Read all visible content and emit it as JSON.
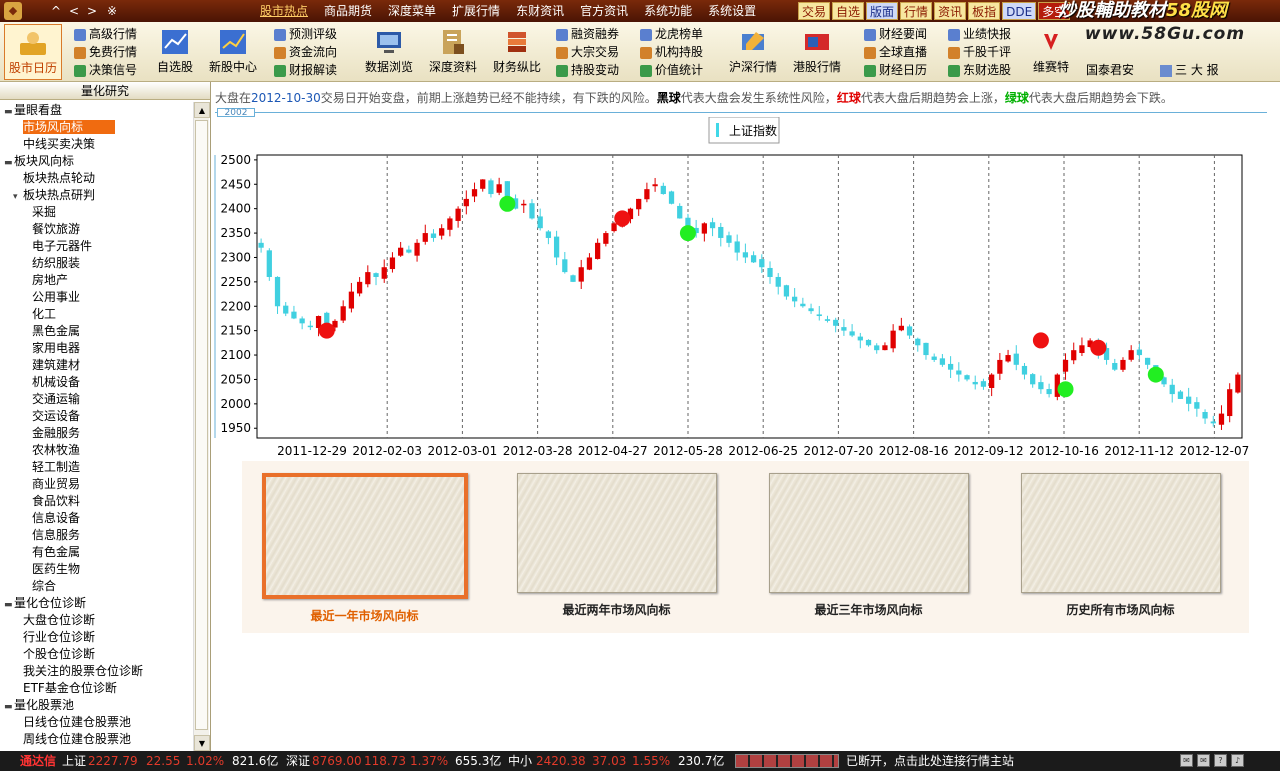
{
  "menubar": {
    "logo": "◆",
    "nav": [
      "^",
      "<",
      ">",
      "※"
    ],
    "menus": [
      {
        "label": "股市热点",
        "active": true
      },
      {
        "label": "商品期货"
      },
      {
        "label": "深度菜单"
      },
      {
        "label": "扩展行情"
      },
      {
        "label": "东财资讯"
      },
      {
        "label": "官方资讯"
      },
      {
        "label": "系统功能"
      },
      {
        "label": "系统设置"
      }
    ],
    "quick_buttons": [
      {
        "label": "交易",
        "style": ""
      },
      {
        "label": "自选",
        "style": ""
      },
      {
        "label": "版面",
        "style": "blue"
      },
      {
        "label": "行情",
        "style": ""
      },
      {
        "label": "资讯",
        "style": ""
      },
      {
        "label": "板指",
        "style": ""
      },
      {
        "label": "DDE",
        "style": "blue"
      },
      {
        "label": "多空",
        "style": "red"
      }
    ],
    "brand_a": "炒股輔助教材",
    "brand_b": "58股网"
  },
  "toolbar": {
    "url_brand": "www.58Gu.com",
    "big_buttons": [
      {
        "label": "股市日历",
        "icon": "calendar-person-icon",
        "active": true
      },
      {
        "label": "自选股",
        "icon": "chart-icon"
      },
      {
        "label": "新股中心",
        "icon": "chart-icon"
      },
      {
        "label": "数据浏览",
        "icon": "monitor-icon"
      },
      {
        "label": "深度资料",
        "icon": "document-icon"
      },
      {
        "label": "财务纵比",
        "icon": "stack-icon"
      },
      {
        "label": "沪深行情",
        "icon": "pen-icon"
      },
      {
        "label": "港股行情",
        "icon": "flag-icon"
      },
      {
        "label": "维赛特",
        "icon": "v-icon"
      }
    ],
    "col1": [
      "高级行情",
      "免费行情",
      "决策信号"
    ],
    "col2": [
      "预测评级",
      "资金流向",
      "财报解读"
    ],
    "col3": [
      "融资融券",
      "大宗交易",
      "持股变动"
    ],
    "col4": [
      "龙虎榜单",
      "机构持股",
      "价值统计"
    ],
    "col5": [
      "财经要闻",
      "全球直播",
      "财经日历"
    ],
    "col6": [
      "业绩快报",
      "千股千评",
      "东财选股"
    ],
    "extra": [
      "国泰君安",
      "三 大 报"
    ]
  },
  "left_panel": {
    "header": "量化研究",
    "tree": [
      {
        "label": "量眼看盘",
        "level": 0,
        "toggle": "▬"
      },
      {
        "label": "市场风向标",
        "level": 1,
        "selected": true
      },
      {
        "label": "中线买卖决策",
        "level": 1
      },
      {
        "label": "板块风向标",
        "level": 0,
        "toggle": "▬"
      },
      {
        "label": "板块热点轮动",
        "level": 1
      },
      {
        "label": "板块热点研判",
        "level": 1,
        "toggle": "▾"
      },
      {
        "label": "采掘",
        "level": 2
      },
      {
        "label": "餐饮旅游",
        "level": 2
      },
      {
        "label": "电子元器件",
        "level": 2
      },
      {
        "label": "纺织服装",
        "level": 2
      },
      {
        "label": "房地产",
        "level": 2
      },
      {
        "label": "公用事业",
        "level": 2
      },
      {
        "label": "化工",
        "level": 2
      },
      {
        "label": "黑色金属",
        "level": 2
      },
      {
        "label": "家用电器",
        "level": 2
      },
      {
        "label": "建筑建材",
        "level": 2
      },
      {
        "label": "机械设备",
        "level": 2
      },
      {
        "label": "交通运输",
        "level": 2
      },
      {
        "label": "交运设备",
        "level": 2
      },
      {
        "label": "金融服务",
        "level": 2
      },
      {
        "label": "农林牧渔",
        "level": 2
      },
      {
        "label": "轻工制造",
        "level": 2
      },
      {
        "label": "商业贸易",
        "level": 2
      },
      {
        "label": "食品饮料",
        "level": 2
      },
      {
        "label": "信息设备",
        "level": 2
      },
      {
        "label": "信息服务",
        "level": 2
      },
      {
        "label": "有色金属",
        "level": 2
      },
      {
        "label": "医药生物",
        "level": 2
      },
      {
        "label": "综合",
        "level": 2
      },
      {
        "label": "量化仓位诊断",
        "level": 0,
        "toggle": "▬"
      },
      {
        "label": "大盘仓位诊断",
        "level": 1
      },
      {
        "label": "行业仓位诊断",
        "level": 1
      },
      {
        "label": "个股仓位诊断",
        "level": 1
      },
      {
        "label": "我关注的股票仓位诊断",
        "level": 1
      },
      {
        "label": "ETF基金仓位诊断",
        "level": 1
      },
      {
        "label": "量化股票池",
        "level": 0,
        "toggle": "▬"
      },
      {
        "label": "日线仓位建仓股票池",
        "level": 1
      },
      {
        "label": "周线仓位建仓股票池",
        "level": 1
      }
    ]
  },
  "main": {
    "notice": {
      "p1": "大盘在",
      "date": "2012-10-30",
      "p2": "交易日开始变盘，前期上涨趋势已经不能持续，有下跌的风险。",
      "black": "黑球",
      "p3": "代表大盘会发生系统性风险，",
      "red": "红球",
      "p4": "代表大盘后期趋势会上涨，",
      "green": "绿球",
      "p5": "代表大盘后期趋势会下跌。"
    },
    "year_tab": "2002",
    "thumbs": [
      {
        "label": "最近一年市场风向标",
        "active": true
      },
      {
        "label": "最近两年市场风向标"
      },
      {
        "label": "最近三年市场风向标"
      },
      {
        "label": "历史所有市场风向标"
      }
    ]
  },
  "chart_data": {
    "type": "candlestick",
    "legend": "上证指数",
    "y_ticks": [
      1950,
      2000,
      2050,
      2100,
      2150,
      2200,
      2250,
      2300,
      2350,
      2400,
      2450,
      2500
    ],
    "ylim": [
      1930,
      2510
    ],
    "x_ticks": [
      "2011-12-29",
      "2012-02-03",
      "2012-03-01",
      "2012-03-28",
      "2012-04-27",
      "2012-05-28",
      "2012-06-25",
      "2012-07-20",
      "2012-08-16",
      "2012-09-12",
      "2012-10-16",
      "2012-11-12",
      "2012-12-07"
    ],
    "close_series": [
      2320,
      2260,
      2200,
      2185,
      2175,
      2165,
      2160,
      2180,
      2150,
      2170,
      2200,
      2230,
      2250,
      2270,
      2260,
      2280,
      2300,
      2320,
      2310,
      2330,
      2350,
      2340,
      2360,
      2380,
      2400,
      2420,
      2440,
      2460,
      2430,
      2450,
      2420,
      2400,
      2410,
      2380,
      2360,
      2340,
      2300,
      2270,
      2250,
      2280,
      2300,
      2330,
      2350,
      2370,
      2380,
      2400,
      2420,
      2440,
      2450,
      2430,
      2410,
      2380,
      2360,
      2350,
      2370,
      2360,
      2340,
      2330,
      2310,
      2300,
      2290,
      2280,
      2260,
      2240,
      2220,
      2210,
      2200,
      2190,
      2180,
      2170,
      2160,
      2150,
      2140,
      2130,
      2120,
      2110,
      2120,
      2150,
      2160,
      2140,
      2120,
      2100,
      2090,
      2080,
      2070,
      2060,
      2050,
      2040,
      2035,
      2060,
      2090,
      2100,
      2080,
      2060,
      2040,
      2030,
      2020,
      2060,
      2090,
      2110,
      2120,
      2130,
      2110,
      2090,
      2070,
      2090,
      2110,
      2100,
      2080,
      2060,
      2040,
      2020,
      2010,
      2000,
      1990,
      1970,
      1960,
      1980,
      2030,
      2060
    ],
    "markers": [
      {
        "date_index": 8,
        "value": 2150,
        "color": "red"
      },
      {
        "date_index": 30,
        "value": 2410,
        "color": "green"
      },
      {
        "date_index": 44,
        "value": 2380,
        "color": "red"
      },
      {
        "date_index": 52,
        "value": 2350,
        "color": "green"
      },
      {
        "date_index": 95,
        "value": 2130,
        "color": "red"
      },
      {
        "date_index": 98,
        "value": 2030,
        "color": "green"
      },
      {
        "date_index": 102,
        "value": 2115,
        "color": "red"
      },
      {
        "date_index": 109,
        "value": 2060,
        "color": "green"
      }
    ]
  },
  "statusbar": {
    "brand": "通达信",
    "sh_label": "上证",
    "sh_value": "2227.79",
    "sh_change": "22.55",
    "sh_pct": "1.02%",
    "sh_amount": "821.6亿",
    "sz_label": "深证",
    "sz_value": "8769.00",
    "sz_change": "118.73",
    "sz_pct": "1.37%",
    "sz_amount": "655.3亿",
    "zx_label": "中小",
    "zx_value": "2420.38",
    "zx_change": "37.03",
    "zx_pct": "1.55%",
    "zx_amount": "230.7亿",
    "message": "已断开，点击此处连接行情主站",
    "icons": [
      "mail-icon",
      "email-icon",
      "help-icon",
      "alarm-icon"
    ]
  }
}
